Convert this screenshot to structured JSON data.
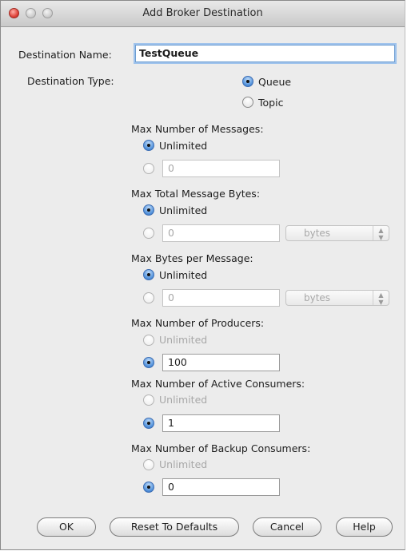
{
  "window": {
    "title": "Add Broker Destination"
  },
  "name": {
    "label": "Destination Name:",
    "value": "TestQueue"
  },
  "type": {
    "label": "Destination Type:",
    "queue": "Queue",
    "topic": "Topic"
  },
  "max_messages": {
    "label": "Max Number of Messages:",
    "unlimited": "Unlimited",
    "value": "0"
  },
  "max_total_bytes": {
    "label": "Max Total Message Bytes:",
    "unlimited": "Unlimited",
    "value": "0",
    "unit": "bytes"
  },
  "max_bytes_per_msg": {
    "label": "Max Bytes per Message:",
    "unlimited": "Unlimited",
    "value": "0",
    "unit": "bytes"
  },
  "max_producers": {
    "label": "Max Number of Producers:",
    "unlimited": "Unlimited",
    "value": "100"
  },
  "max_active_consumers": {
    "label": "Max Number of Active Consumers:",
    "unlimited": "Unlimited",
    "value": "1"
  },
  "max_backup_consumers": {
    "label": "Max Number of Backup Consumers:",
    "unlimited": "Unlimited",
    "value": "0"
  },
  "buttons": {
    "ok": "OK",
    "reset": "Reset To Defaults",
    "cancel": "Cancel",
    "help": "Help"
  }
}
